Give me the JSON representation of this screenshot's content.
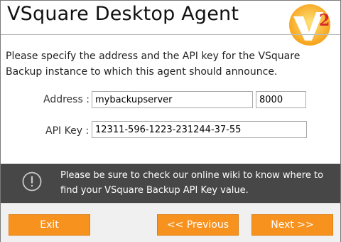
{
  "window": {
    "title": "VSquare Desktop Agent",
    "logo_icon": "vsquare-v2-logo",
    "logo_number": "2"
  },
  "form": {
    "intro": "Please specify the address and the API key for the VSquare Backup instance to which this agent should announce.",
    "address_label": "Address :",
    "address_value": "mybackupserver",
    "port_value": "8000",
    "apikey_label": "API Key :",
    "apikey_value": "12311-596-1223-231244-37-55"
  },
  "notice": {
    "icon": "exclamation-circle-icon",
    "text": "Please be sure to check our online wiki to know where to find your VSquare Backup API Key value."
  },
  "buttons": {
    "exit": "Exit",
    "previous": "<< Previous",
    "next": "Next >>"
  },
  "colors": {
    "accent": "#f7921e",
    "notice_bg": "#474747",
    "footer_bg": "#f0f0f0"
  }
}
